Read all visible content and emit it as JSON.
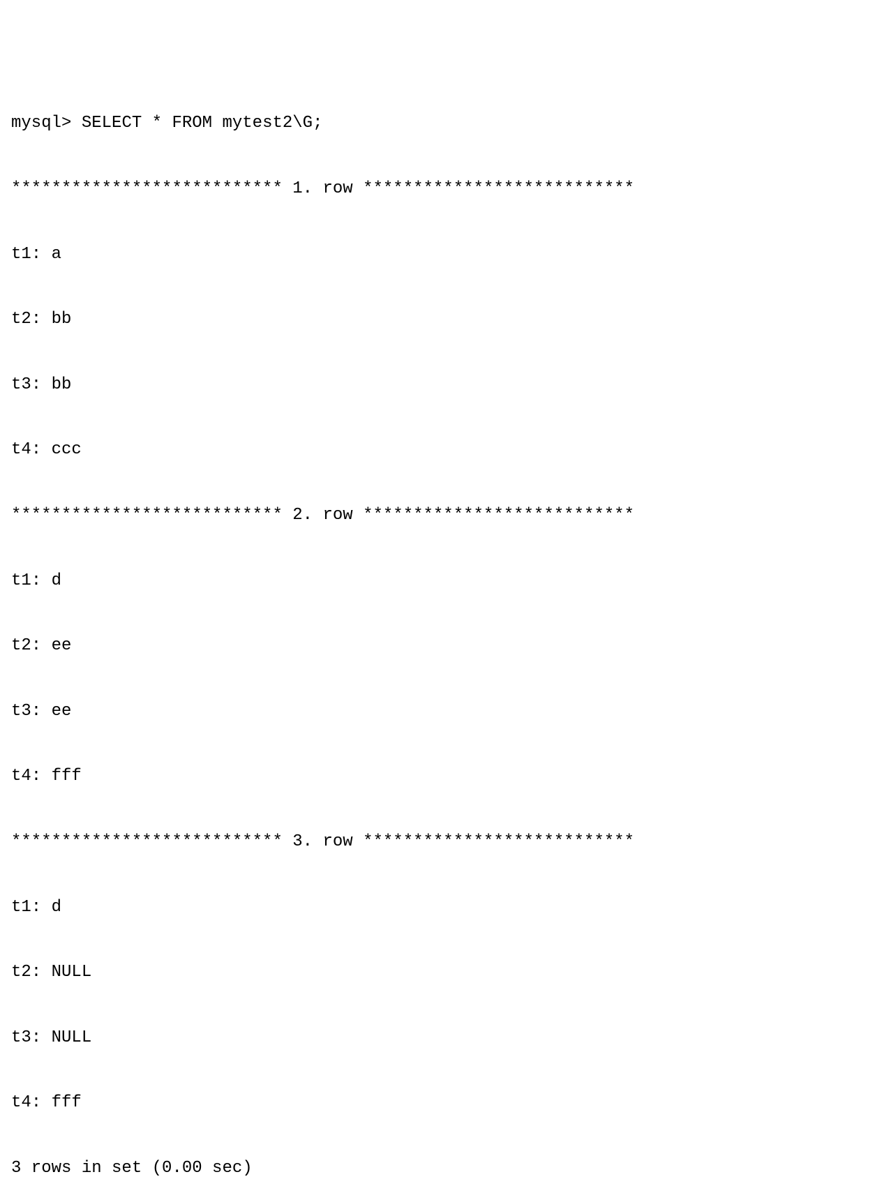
{
  "prompt": "mysql> ",
  "command": "SELECT * FROM mytest2\\G;",
  "row_separator_left": "*************************** ",
  "row_separator_right": " ***************************",
  "row_word": ". row",
  "rows": [
    {
      "n": "1",
      "fields": {
        "t1": "a",
        "t2": "bb",
        "t3": "bb",
        "t4": "ccc"
      }
    },
    {
      "n": "2",
      "fields": {
        "t1": "d",
        "t2": "ee",
        "t3": "ee",
        "t4": "fff"
      }
    },
    {
      "n": "3",
      "fields": {
        "t1": "d",
        "t2": "NULL",
        "t3": "NULL",
        "t4": "fff"
      }
    }
  ],
  "footer": "3 rows in set (0.00 sec)"
}
